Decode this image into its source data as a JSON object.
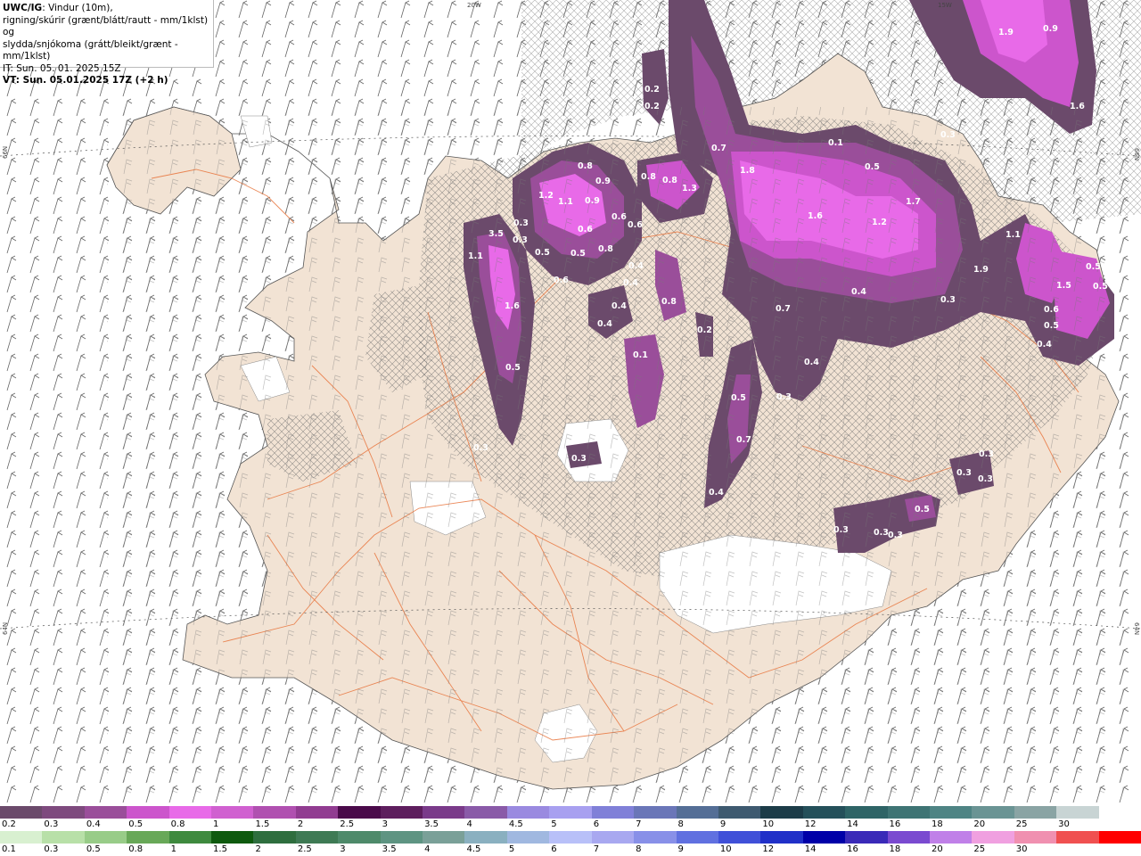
{
  "header": {
    "line1_bold": "UWC/IG",
    "line1_rest": ": Vindur (10m),",
    "line2": "rigning/skúrir (grænt/blátt/rautt - mm/1klst) og",
    "line3": "slydda/snjókoma (grátt/bleikt/grænt - mm/1klst)",
    "line4": "IT: Sun. 05. 01. 2025 15Z",
    "line5": "VT: Sun. 05.01.2025 17Z (+2 h)"
  },
  "map_edge_labels": {
    "top_20w": "20W",
    "top_15w": "15W",
    "left_66n": "66N",
    "right_66n": "66N",
    "left_64n": "64N",
    "right_64n": "64N"
  },
  "precip_labels": [
    {
      "id": "a1",
      "text": "1.9"
    },
    {
      "id": "a2",
      "text": "0.9"
    },
    {
      "id": "a3",
      "text": "1.6"
    },
    {
      "id": "a4",
      "text": "0.2"
    },
    {
      "id": "a5",
      "text": "0.2"
    },
    {
      "id": "a6",
      "text": "0.7"
    },
    {
      "id": "a7",
      "text": "0.1"
    },
    {
      "id": "a8",
      "text": "0.5"
    },
    {
      "id": "a9",
      "text": "0.3"
    },
    {
      "id": "b1",
      "text": "0.8"
    },
    {
      "id": "b2",
      "text": "1.8"
    },
    {
      "id": "b3",
      "text": "0.8"
    },
    {
      "id": "b4",
      "text": "0.8"
    },
    {
      "id": "b5",
      "text": "1.3"
    },
    {
      "id": "b6",
      "text": "1.2"
    },
    {
      "id": "b7",
      "text": "1.1"
    },
    {
      "id": "b8",
      "text": "0.9"
    },
    {
      "id": "b9",
      "text": "0.9"
    },
    {
      "id": "c1",
      "text": "1.6"
    },
    {
      "id": "c2",
      "text": "1.2"
    },
    {
      "id": "c3",
      "text": "1.7"
    },
    {
      "id": "c4",
      "text": "0.3"
    },
    {
      "id": "c5",
      "text": "0.6"
    },
    {
      "id": "c6",
      "text": "0.6"
    },
    {
      "id": "c7",
      "text": "0.6"
    },
    {
      "id": "c8",
      "text": "3.5"
    },
    {
      "id": "c9",
      "text": "0.3"
    },
    {
      "id": "d1",
      "text": "1.1"
    },
    {
      "id": "d2",
      "text": "0.5"
    },
    {
      "id": "d3",
      "text": "0.5"
    },
    {
      "id": "d4",
      "text": "0.8"
    },
    {
      "id": "d5",
      "text": "0.6"
    },
    {
      "id": "d6",
      "text": "0.4"
    },
    {
      "id": "d7",
      "text": "0.4"
    },
    {
      "id": "d8",
      "text": "0.8"
    },
    {
      "id": "d9",
      "text": "1.1"
    },
    {
      "id": "e1",
      "text": "1.9"
    },
    {
      "id": "e2",
      "text": "1.5"
    },
    {
      "id": "e3",
      "text": "0.5"
    },
    {
      "id": "e4",
      "text": "0.5"
    },
    {
      "id": "e5",
      "text": "0.4"
    },
    {
      "id": "e6",
      "text": "0.3"
    },
    {
      "id": "e7",
      "text": "0.4"
    },
    {
      "id": "e8",
      "text": "1.6"
    },
    {
      "id": "e9",
      "text": "0.7"
    },
    {
      "id": "f1",
      "text": "0.2"
    },
    {
      "id": "f2",
      "text": "0.4"
    },
    {
      "id": "f3",
      "text": "0.4"
    },
    {
      "id": "f4",
      "text": "0.5"
    },
    {
      "id": "f5",
      "text": "0.5"
    },
    {
      "id": "f6",
      "text": "0.6"
    },
    {
      "id": "f7",
      "text": "0.1"
    },
    {
      "id": "f8",
      "text": "0.5"
    },
    {
      "id": "f9",
      "text": "0.3"
    },
    {
      "id": "g1",
      "text": "0.7"
    },
    {
      "id": "g2",
      "text": "0.3"
    },
    {
      "id": "g3",
      "text": "0.4"
    },
    {
      "id": "g4",
      "text": "0.3"
    },
    {
      "id": "g5",
      "text": "0.3"
    },
    {
      "id": "g6",
      "text": "0.3"
    },
    {
      "id": "g7",
      "text": "0.3"
    },
    {
      "id": "g8",
      "text": "0.3"
    },
    {
      "id": "g9",
      "text": "0.5"
    },
    {
      "id": "h1",
      "text": "0.3"
    },
    {
      "id": "h2",
      "text": "0.3"
    },
    {
      "id": "h3",
      "text": "0.4"
    }
  ],
  "legend_snow": {
    "colors": [
      "#6b4a6b",
      "#7e4a7e",
      "#9a4e9a",
      "#cc55cc",
      "#e86ae8",
      "#d060d0",
      "#b050b0",
      "#913c91",
      "#4a0a4a",
      "#5e1e5e",
      "#7a3a8a",
      "#8a5aa8",
      "#9a8ae0",
      "#a8a0f0",
      "#8080d8",
      "#6a76b8",
      "#546e96",
      "#3e5a70",
      "#1c3c48",
      "#24505a",
      "#2e6466",
      "#3e7474",
      "#4e8484",
      "#6a9494",
      "#8aa4a4",
      "#c8d4d4",
      "#ffffff"
    ],
    "ticks": [
      "0.2",
      "0.3",
      "0.4",
      "0.5",
      "0.8",
      "1",
      "1.5",
      "2",
      "2.5",
      "3",
      "3.5",
      "4",
      "4.5",
      "5",
      "6",
      "7",
      "8",
      "9",
      "10",
      "12",
      "14",
      "16",
      "18",
      "20",
      "25",
      "30"
    ]
  },
  "legend_rain": {
    "colors": [
      "#d8f0d0",
      "#b8e0a8",
      "#98cc88",
      "#68a858",
      "#3e8a3e",
      "#0e5a0e",
      "#2e6e3e",
      "#3e7a54",
      "#4e8a6a",
      "#5e9482",
      "#7aa098",
      "#8ab0c0",
      "#a0b8e0",
      "#b8c0f8",
      "#a8a8f0",
      "#8890e8",
      "#6070e0",
      "#4050d8",
      "#2030c8",
      "#0000a8",
      "#3a2ab8",
      "#7a4ad0",
      "#c080e8",
      "#f0a0e0",
      "#f090b0",
      "#f05050",
      "#ff0000"
    ],
    "ticks": [
      "0.1",
      "0.3",
      "0.5",
      "0.8",
      "1",
      "1.5",
      "2",
      "2.5",
      "3",
      "3.5",
      "4",
      "4.5",
      "5",
      "6",
      "7",
      "8",
      "9",
      "10",
      "12",
      "14",
      "16",
      "18",
      "20",
      "25",
      "30"
    ]
  }
}
